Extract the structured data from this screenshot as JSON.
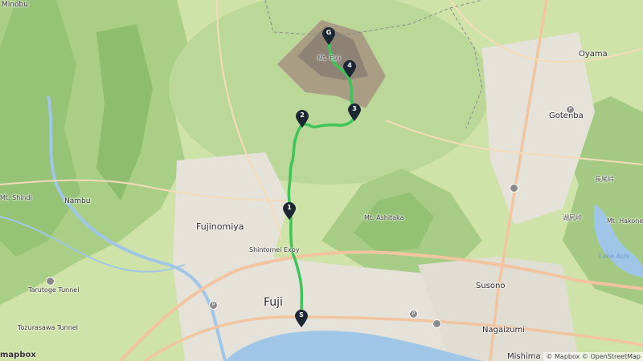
{
  "map": {
    "labels": {
      "minobu": "Minobu",
      "mt_fuji": "Mt. Fuji",
      "oyama": "Oyama",
      "gotenba": "Gotenba",
      "mt_shindi": "Mt. Shindi",
      "nambu": "Nambu",
      "fujinomiya": "Fujinomiya",
      "mt_ashitaka": "Mt. Ashitaka",
      "mt_hakone": "Mt. Hakone",
      "shintomei": "Shintomei Expy",
      "tarutoge": "Tarutoge Tunnel",
      "tozurasawa": "Tozurasawa Tunnel",
      "fuji": "Fuji",
      "susono": "Susono",
      "nagaizumi": "Nagaizumi",
      "mishima": "Mishima",
      "lake_ashi": "Lake Ashi",
      "jp_hakone_pass": "長尾峠",
      "jp_kojiri": "湖尻峠"
    },
    "markers": [
      {
        "id": "marker-start",
        "label": "S"
      },
      {
        "id": "marker-1",
        "label": "1"
      },
      {
        "id": "marker-2",
        "label": "2"
      },
      {
        "id": "marker-3",
        "label": "3"
      },
      {
        "id": "marker-4",
        "label": "4"
      },
      {
        "id": "marker-goal",
        "label": "G"
      }
    ],
    "route_color": "#3fc45a",
    "marker_color": "#1d2733"
  },
  "attribution": {
    "logo": "mapbox",
    "credits": "© Mapbox © OpenStreetMap"
  }
}
